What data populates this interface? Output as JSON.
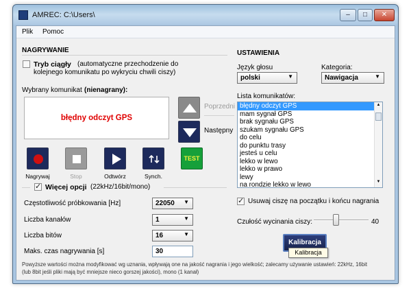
{
  "window": {
    "title": "AMREC: C:\\Users\\",
    "min": "–",
    "max": "□",
    "close": "✕"
  },
  "menu": [
    "Plik",
    "Pomoc"
  ],
  "recording": {
    "header": "NAGRYWANIE",
    "continuous_bold": "Tryb ciągły",
    "continuous_desc1": "(automatyczne przechodzenie do",
    "continuous_desc2": "kolejnego komunikatu po wykryciu chwili ciszy)",
    "selected_label": "Wybrany komunikat",
    "selected_status": "(nienagrany):",
    "selected_text": "błędny odczyt GPS",
    "prev": "Poprzedni",
    "next": "Następny",
    "controls": {
      "record": "Nagrywaj",
      "stop": "Stop",
      "play": "Odtwórz",
      "sync": "Synch.",
      "test": "TEST"
    }
  },
  "options": {
    "more_bold": "Więcej opcji",
    "more_desc": "(22kHz/16bit/mono)",
    "rate_label": "Częstotliwość próbkowania [Hz]",
    "rate_value": "22050",
    "channels_label": "Liczba kanałów",
    "channels_value": "1",
    "bits_label": "Liczba bitów",
    "bits_value": "16",
    "max_label": "Maks. czas nagrywania [s]",
    "max_value": "30",
    "footnote1": "Powyższe wartości można modyfikować wg uznania, wpływają one na jakość nagrania i jego wielkość; zalecamy używanie ustawień: 22kHz, 16bit",
    "footnote2": "(lub 8bit jeśli pliki mają być mniejsze nieco gorszej jakości), mono (1 kanał)"
  },
  "settings": {
    "header": "USTAWIENIA",
    "lang_label": "Język głosu",
    "lang_value": "polski",
    "cat_label": "Kategoria:",
    "cat_value": "Nawigacja",
    "list_label": "Lista komunikatów:",
    "list": [
      "błędny odczyt GPS",
      "mam sygnał GPS",
      "brak sygnału GPS",
      "szukam sygnału GPS",
      "do celu",
      "do punktu trasy",
      "jesteś u celu",
      "lekko w lewo",
      "lekko w prawo",
      "lewy",
      "na rondzie lekko w lewo"
    ],
    "trim_label": "Usuwaj ciszę na początku i końcu nagrania",
    "sens_label": "Czułość wycinania ciszy:",
    "sens_value": "40",
    "sens_level": 0.4,
    "calib": "Kalibracja",
    "tooltip": "Kalibracja"
  }
}
